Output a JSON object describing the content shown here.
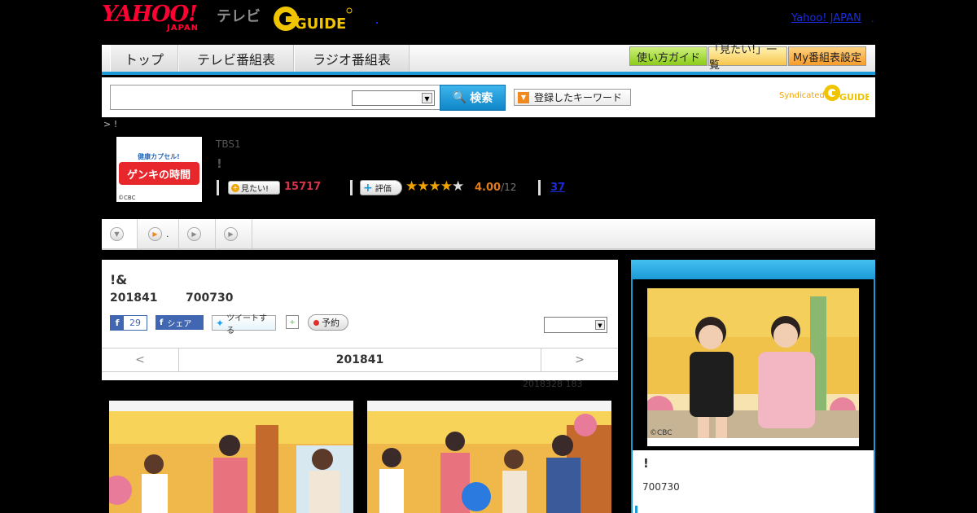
{
  "header": {
    "yahoo_logo": "YAHOO!",
    "yahoo_sub": "JAPAN",
    "tv_label": "テレビ",
    "gguide_logo": "GUIDE",
    "yahoo_japan_link": "Yahoo! JAPAN",
    "dot": "."
  },
  "nav": {
    "tabs": [
      "トップ",
      "テレビ番組表",
      "ラジオ番組表"
    ],
    "buttons": [
      "使い方ガイド",
      "「見たい!」一覧",
      "My番組表設定"
    ]
  },
  "search": {
    "input_value": "",
    "select_value": "",
    "search_button": "検索",
    "keyword_button": "登録したキーワード",
    "syndicated": "Syndicated",
    "syndicated_logo": "GUIDE"
  },
  "breadcrumb": "> !",
  "program": {
    "image_text_top": "健康カプセル!",
    "image_text_main": "ゲンキの時間",
    "image_credit": "©CBC",
    "channel": "TBS1",
    "title": "!",
    "mitai_button": "見たい!",
    "mitai_count": "15717",
    "hyoka_button": "評価",
    "rating_value": 4.0,
    "rating": "4.00",
    "rating_count": "/12",
    "review_count": "37"
  },
  "tabs": [
    {
      "label": "",
      "icon": "down-arrow-icon"
    },
    {
      "label": ".",
      "icon": "play-icon"
    },
    {
      "label": "",
      "icon": "play-icon"
    },
    {
      "label": "",
      "icon": "play-icon"
    }
  ],
  "episode": {
    "title": "!&",
    "date": "201841",
    "number": "700730",
    "fb_like_count": "29",
    "fb_share": "シェア",
    "tweet": "ツイートする",
    "reserve": "予約",
    "select_value": "",
    "pager_prev": "<",
    "pager_current": "201841",
    "pager_next": ">",
    "updated": "2018328  183"
  },
  "photos": [
    {
      "name": "studio-photo-1",
      "caption": ""
    },
    {
      "name": "studio-photo-2",
      "caption": ""
    }
  ],
  "side": {
    "header": "",
    "image_credit": "©CBC",
    "title": "!",
    "number": "700730"
  },
  "colors": {
    "accent_blue": "#1b9ad8",
    "link_blue": "#1a2bd8",
    "yahoo_red": "#ff0033",
    "gguide_yellow": "#f0c400",
    "mitai_red": "#d6334d",
    "rating_orange": "#e07b1b"
  }
}
